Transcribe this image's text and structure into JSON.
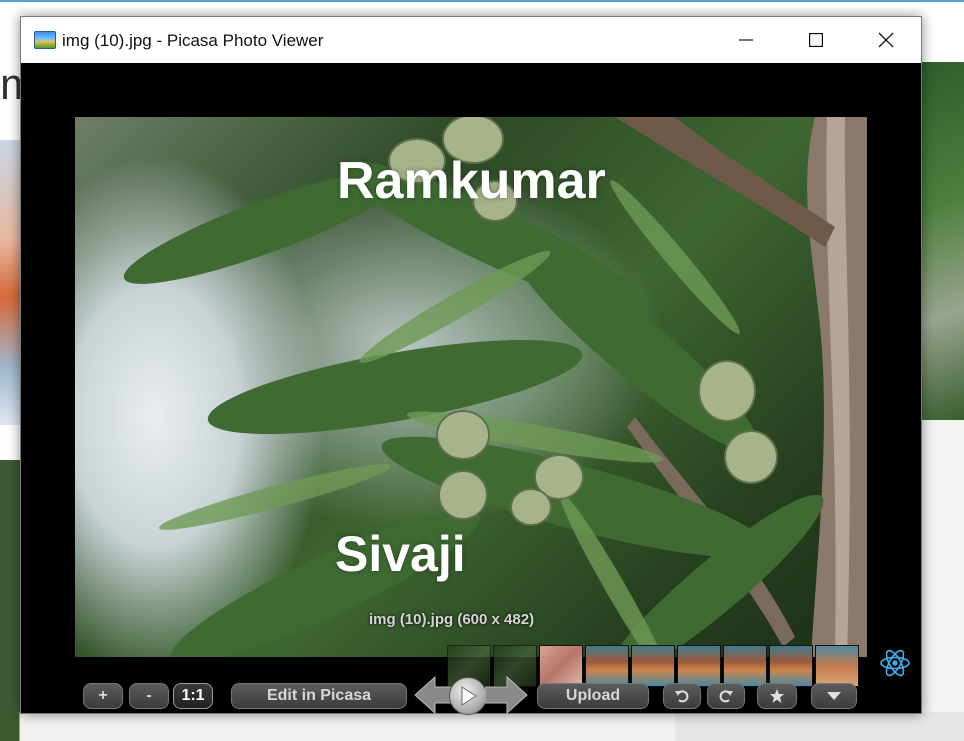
{
  "window": {
    "title": "img (10).jpg - Picasa Photo Viewer",
    "minimize_icon": "minimize-icon",
    "maximize_icon": "maximize-icon",
    "close_icon": "close-icon"
  },
  "photo": {
    "caption_top": "Ramkumar",
    "caption_bottom": "Sivaji",
    "info": "img (10).jpg (600 x 482)"
  },
  "filmstrip": {
    "thumbnail_count": 9,
    "icon": "react-icon"
  },
  "toolbar": {
    "zoom_in": "+",
    "zoom_out": "-",
    "actual_size": "1:1",
    "edit": "Edit in Picasa",
    "upload": "Upload",
    "previous_icon": "arrow-left-icon",
    "play_icon": "play-icon",
    "next_icon": "arrow-right-icon",
    "rotate_left_icon": "rotate-left-icon",
    "rotate_right_icon": "rotate-right-icon",
    "star_icon": "star-icon",
    "more_icon": "chevron-down-icon"
  },
  "background": {
    "left_fragment_text": "m"
  },
  "colors": {
    "viewer_background": "#000000",
    "toolbar_button": "#4a4a4a",
    "button_text": "#d8d8d8",
    "react_icon": "#3ab4f2"
  }
}
